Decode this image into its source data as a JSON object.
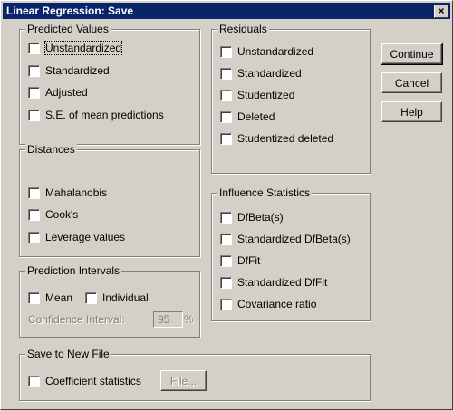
{
  "window": {
    "title": "Linear Regression: Save",
    "close_label": "×"
  },
  "predicted": {
    "legend": "Predicted Values",
    "items": [
      "Unstandardized",
      "Standardized",
      "Adjusted",
      "S.E. of mean predictions"
    ]
  },
  "distances": {
    "legend": "Distances",
    "items": [
      "Mahalanobis",
      "Cook's",
      "Leverage values"
    ]
  },
  "prediction_intervals": {
    "legend": "Prediction Intervals",
    "mean_label": "Mean",
    "individual_label": "Individual",
    "confidence_label": "Confidence Interval:",
    "confidence_value": "95",
    "percent": "%"
  },
  "residuals": {
    "legend": "Residuals",
    "items": [
      "Unstandardized",
      "Standardized",
      "Studentized",
      "Deleted",
      "Studentized deleted"
    ]
  },
  "influence": {
    "legend": "Influence Statistics",
    "items": [
      "DfBeta(s)",
      "Standardized DfBeta(s)",
      "DfFit",
      "Standardized DfFit",
      "Covariance ratio"
    ]
  },
  "save_file": {
    "legend": "Save to New File",
    "coef_label": "Coefficient statistics",
    "file_button": "File..."
  },
  "buttons": {
    "continue": "Continue",
    "cancel": "Cancel",
    "help": "Help"
  }
}
